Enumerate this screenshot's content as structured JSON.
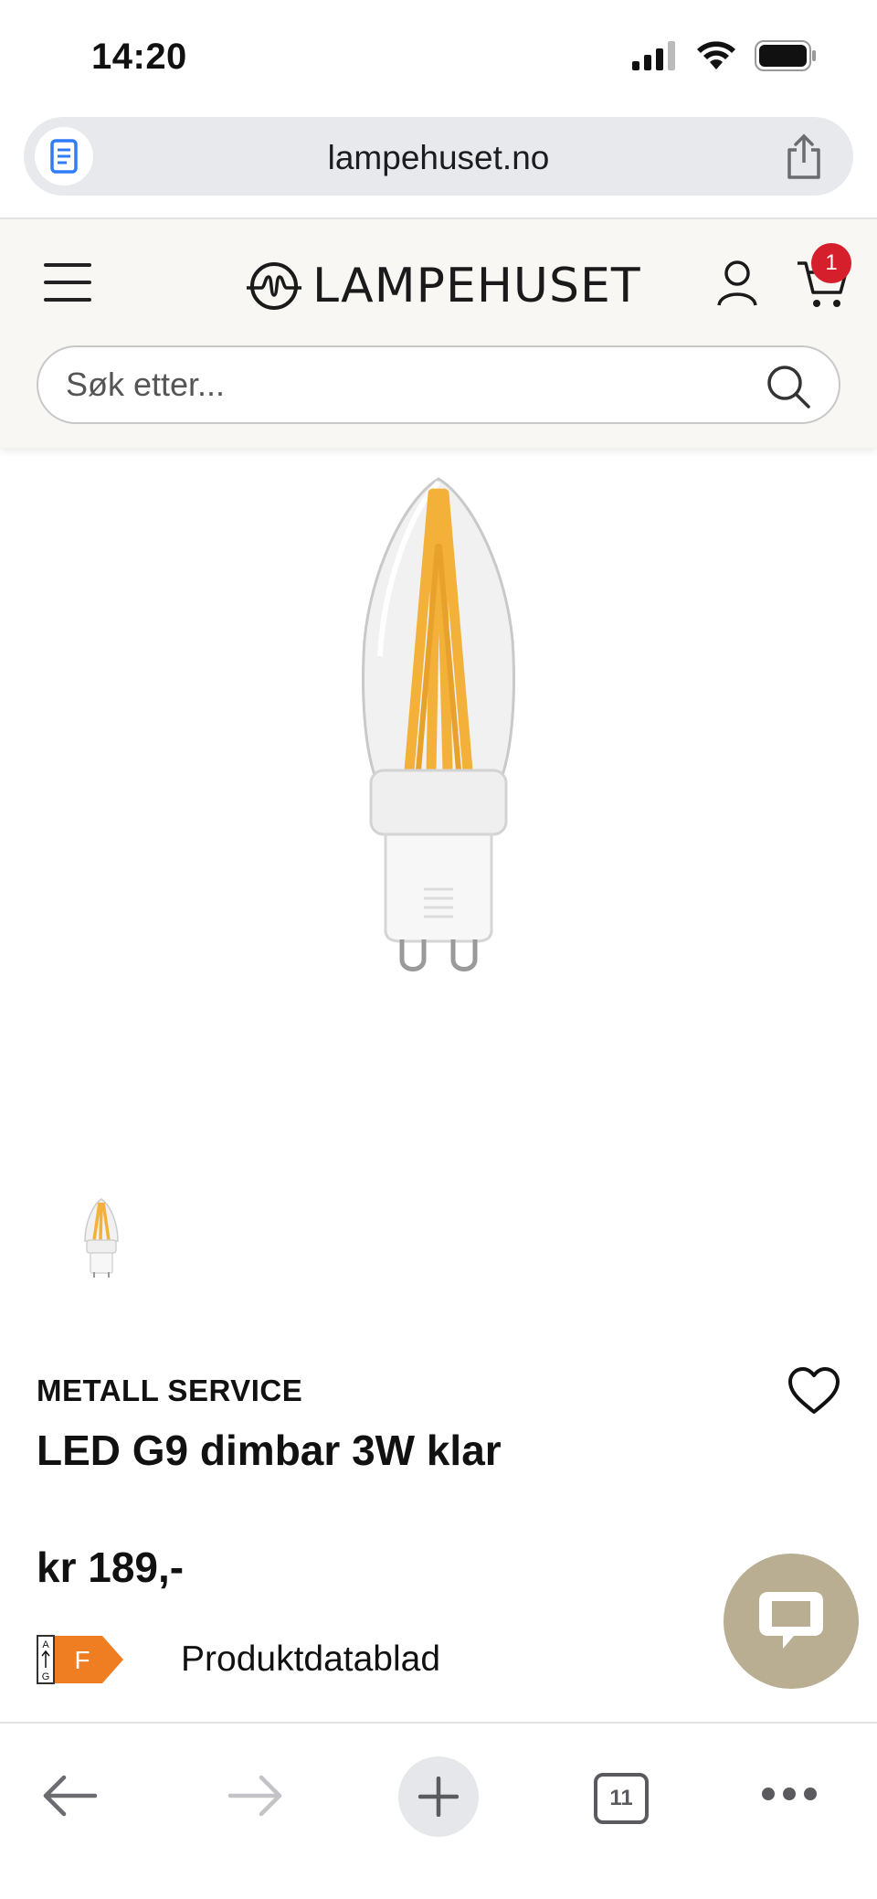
{
  "status_bar": {
    "time": "14:20"
  },
  "browser": {
    "url": "lampehuset.no",
    "tab_count": "11"
  },
  "site": {
    "logo_text": "LAMPEHUSET",
    "cart_count": "1",
    "search_placeholder": "Søk etter..."
  },
  "product": {
    "brand": "METALL SERVICE",
    "title": "LED G9 dimbar 3W klar",
    "price": "kr 189,-",
    "energy_class": "F",
    "energy_scale": [
      "A",
      "G"
    ],
    "datasheet_label": "Produktdatablad"
  },
  "colors": {
    "accent_chat": "#b9ae92",
    "badge_red": "#d61f2c",
    "energy_orange": "#ef7d22",
    "filament": "#f4b13a"
  },
  "icons": [
    "reader-icon",
    "share-icon",
    "hamburger-menu-icon",
    "lampehuset-logo",
    "account-icon",
    "cart-icon",
    "search-icon",
    "heart-icon",
    "chat-icon",
    "back-arrow-icon",
    "forward-arrow-icon",
    "plus-icon",
    "tabs-icon",
    "more-icon"
  ]
}
